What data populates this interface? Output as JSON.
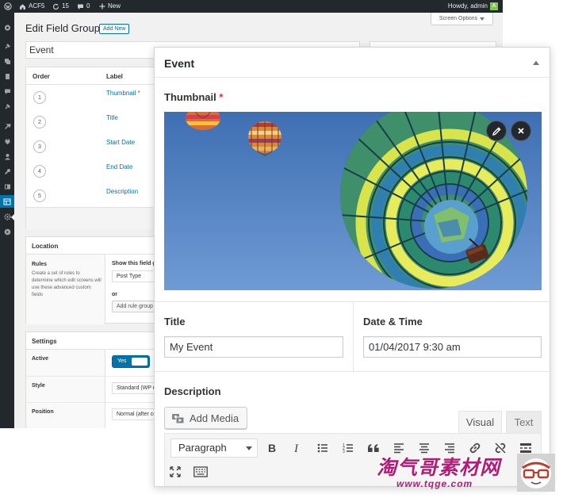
{
  "admin_bar": {
    "site_name": "ACF5",
    "updates": "15",
    "comments": "0",
    "new": "New",
    "greeting": "Howdy, admin",
    "avatar_letter": "A"
  },
  "screen_options": "Screen Options",
  "page": {
    "title": "Edit Field Group",
    "add_new": "Add New",
    "group_title_value": "Event"
  },
  "fields_table": {
    "col_order": "Order",
    "col_label": "Label",
    "rows": [
      {
        "order": "1",
        "label": "Thumbnail",
        "required": "*"
      },
      {
        "order": "2",
        "label": "Title",
        "required": ""
      },
      {
        "order": "3",
        "label": "Start Date",
        "required": ""
      },
      {
        "order": "4",
        "label": "End Date",
        "required": ""
      },
      {
        "order": "5",
        "label": "Description",
        "required": ""
      }
    ]
  },
  "location": {
    "heading": "Location",
    "rules_title": "Rules",
    "rules_desc": "Create a set of rules to determine which edit screens will use these advanced custom fields",
    "show_if": "Show this field group if",
    "param_value": "Post Type",
    "or": "or",
    "add_rule_group": "Add rule group"
  },
  "settings": {
    "heading": "Settings",
    "active_label": "Active",
    "active_value": "Yes",
    "style_label": "Style",
    "style_value": "Standard (WP metabox)",
    "position_label": "Position",
    "position_value": "Normal (after content)"
  },
  "popup": {
    "title": "Event",
    "thumbnail_label": "Thumbnail",
    "required_mark": "*",
    "title_label": "Title",
    "title_value": "My Event",
    "datetime_label": "Date & Time",
    "datetime_value": "01/04/2017 9:30 am",
    "description_label": "Description",
    "add_media": "Add Media",
    "tab_visual": "Visual",
    "tab_text": "Text",
    "format_value": "Paragraph",
    "toolbar_icons": [
      "bold-icon",
      "italic-icon",
      "bullet-list-icon",
      "numbered-list-icon",
      "blockquote-icon",
      "align-left-icon",
      "align-center-icon",
      "align-right-icon",
      "link-icon",
      "unlink-icon",
      "read-more-icon",
      "fullscreen-icon",
      "keyboard-icon"
    ]
  },
  "watermark": {
    "text": "淘气哥素材网",
    "url": "www.tqge.com"
  },
  "colors": {
    "admin_dark": "#23282d",
    "accent": "#0073aa",
    "required": "#dc3232",
    "sky": "#4a7ab8",
    "watermark": "#b01d76"
  }
}
